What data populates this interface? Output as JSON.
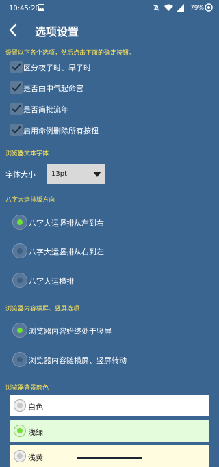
{
  "status_bar": {
    "time": "10:45:20",
    "battery": "79%",
    "icons": [
      "image-icon",
      "mute-icon",
      "wifi-icon",
      "signal-icon",
      "battery-icon",
      "data-saver-icon"
    ]
  },
  "app_bar": {
    "title": "选项设置",
    "back_icon": "back-arrow-icon"
  },
  "hint": "设置以下各个选项，然后点击下面的确定按钮。",
  "checkboxes": [
    {
      "label": "区分夜子时、早子时",
      "checked": true
    },
    {
      "label": "是否由中气起命宫",
      "checked": true
    },
    {
      "label": "是否简批流年",
      "checked": true
    },
    {
      "label": "启用命例删除所有按钮",
      "checked": true
    }
  ],
  "font_section": {
    "title": "浏览器文本字体",
    "label": "字体大小",
    "selected": "13pt"
  },
  "bazi_section": {
    "title": "八字大运排版方向",
    "options": [
      {
        "label": "八字大运竖排从左到右",
        "selected": true
      },
      {
        "label": "八字大运竖排从右到左",
        "selected": false
      },
      {
        "label": "八字大运横排",
        "selected": false
      }
    ]
  },
  "orientation_section": {
    "title": "浏览器内容横屏、竖屏选项",
    "options": [
      {
        "label": "浏览器内容始终处于竖屏",
        "selected": true
      },
      {
        "label": "浏览器内容随横屏、竖屏转动",
        "selected": false
      }
    ]
  },
  "bg_section": {
    "title": "浏览器背景颜色",
    "options": [
      {
        "label": "白色",
        "selected": false,
        "color": "#ffffff"
      },
      {
        "label": "浅绿",
        "selected": true,
        "color": "#e5fcdc"
      },
      {
        "label": "浅黄",
        "selected": false,
        "color": "#fffce0"
      }
    ]
  },
  "colors": {
    "background": "#3a6591",
    "section_title": "#ffe65c",
    "radio_on": "#6fe036"
  }
}
